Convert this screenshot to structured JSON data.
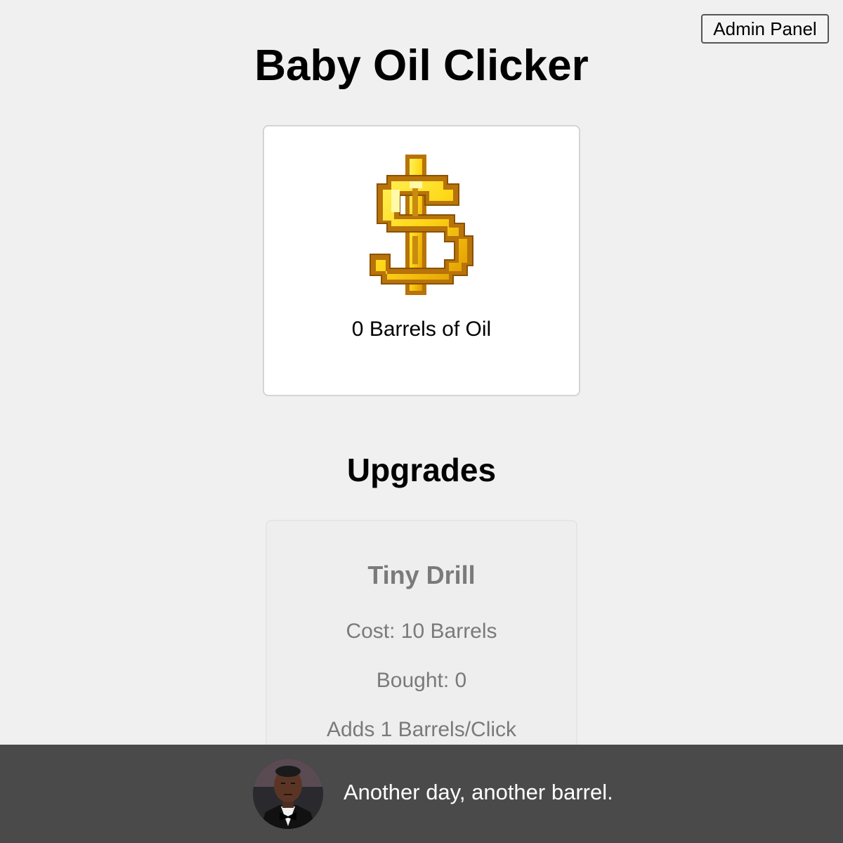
{
  "header": {
    "admin_button_label": "Admin Panel",
    "title": "Baby Oil Clicker"
  },
  "clicker": {
    "icon": "dollar-sign-icon",
    "barrel_count": "0 Barrels of Oil"
  },
  "upgrades": {
    "heading": "Upgrades",
    "items": [
      {
        "name": "Tiny Drill",
        "cost": "Cost: 10 Barrels",
        "bought": "Bought: 0",
        "effect": "Adds 1 Barrels/Click"
      }
    ]
  },
  "toast": {
    "avatar": "person-avatar",
    "message": "Another day, another barrel."
  },
  "colors": {
    "page_background": "#f0f0f0",
    "toast_background": "#4a4a4a",
    "disabled_text": "#7a7a7a",
    "coin_gold": "#f2c200"
  }
}
